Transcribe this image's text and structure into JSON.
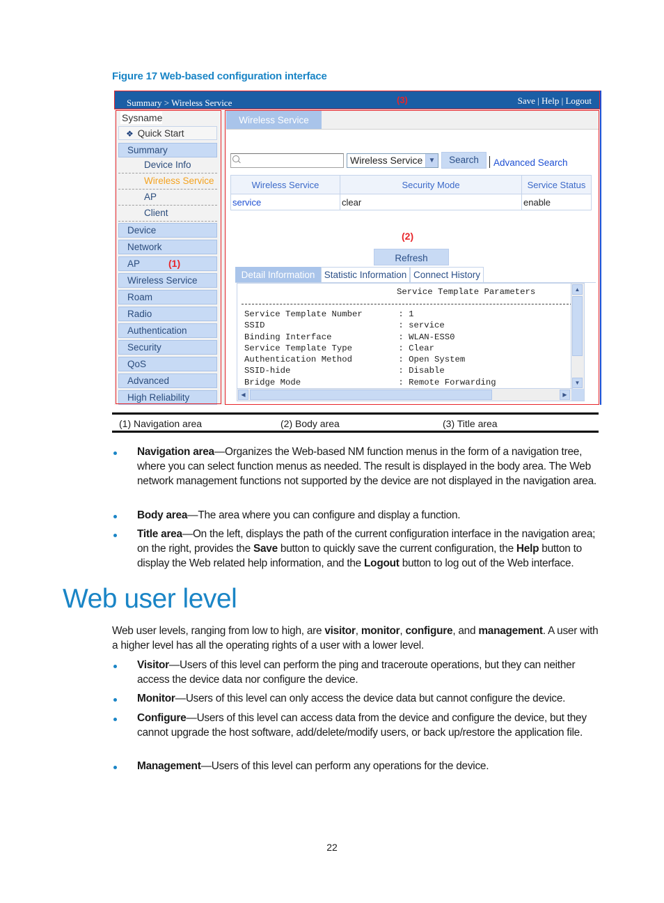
{
  "figure_caption": "Figure 17 Web-based configuration interface",
  "ui": {
    "title_area": {
      "breadcrumb": "Summary > Wireless Service",
      "save": "Save",
      "help": "Help",
      "logout": "Logout",
      "separator": " | "
    },
    "markers": {
      "nav": "(1)",
      "body": "(2)",
      "title": "(3)"
    },
    "navigation": {
      "sysname": "Sysname",
      "quick_start": "Quick Start",
      "summary": {
        "label": "Summary",
        "children": [
          "Device Info",
          "Wireless Service",
          "AP",
          "Client"
        ],
        "active_child": "Wireless Service"
      },
      "groups": [
        "Device",
        "Network",
        "AP",
        "Wireless Service",
        "Roam",
        "Radio",
        "Authentication",
        "Security",
        "QoS",
        "Advanced",
        "High Reliability"
      ]
    },
    "body": {
      "tab": "Wireless Service",
      "search": {
        "value": "",
        "placeholder": ""
      },
      "search_field": "Wireless Service",
      "search_button": "Search",
      "advanced_search": "Advanced Search",
      "table": {
        "columns": [
          "Wireless Service",
          "Security Mode",
          "Service Status"
        ],
        "rows": [
          [
            "service",
            "clear",
            "enable"
          ]
        ]
      },
      "refresh_button": "Refresh",
      "detail_tabs": [
        "Detail Information",
        "Statistic Information",
        "Connect History"
      ],
      "active_detail_tab": "Detail Information",
      "detail_title": "Service Template Parameters",
      "parameters": [
        {
          "name": "Service Template Number",
          "value": "1"
        },
        {
          "name": "SSID",
          "value": "service"
        },
        {
          "name": "Binding Interface",
          "value": "WLAN-ESS0"
        },
        {
          "name": "Service Template Type",
          "value": "Clear"
        },
        {
          "name": "Authentication Method",
          "value": "Open System"
        },
        {
          "name": "SSID-hide",
          "value": "Disable"
        },
        {
          "name": "Bridge Mode",
          "value": "Remote Forwarding"
        }
      ]
    }
  },
  "legend": [
    "(1) Navigation area",
    "(2) Body area",
    "(3) Title area"
  ],
  "bullets_areas": [
    {
      "term": "Navigation area",
      "text": "—Organizes the Web-based NM function menus in the form of a navigation tree, where you can select function menus as needed. The result is displayed in the body area. The Web network management functions not supported by the device are not displayed in the navigation area."
    },
    {
      "term": "Body area",
      "text": "—The area where you can configure and display a function."
    },
    {
      "term": "Title area",
      "text_parts": [
        "—On the left, displays the path of the current configuration interface in the navigation area; on the right, provides the ",
        "Save",
        " button to quickly save the current configuration, the ",
        "Help",
        " button to display the Web related help information, and the ",
        "Logout",
        " button to log out of the Web interface."
      ]
    }
  ],
  "section_heading": "Web user level",
  "intro_parts": [
    "Web user levels, ranging from low to high, are ",
    "visitor",
    ", ",
    "monitor",
    ", ",
    "configure",
    ", and ",
    "management",
    ". A user with a higher level has all the operating rights of a user with a lower level."
  ],
  "bullets_levels": [
    {
      "term": "Visitor",
      "text": "—Users of this level can perform the ping and traceroute operations, but they can neither access the device data nor configure the device."
    },
    {
      "term": "Monitor",
      "text": "—Users of this level can only access the device data but cannot configure the device."
    },
    {
      "term": "Configure",
      "text": "—Users of this level can access data from the device and configure the device, but they cannot upgrade the host software, add/delete/modify users, or back up/restore the application file."
    },
    {
      "term": "Management",
      "text": "—Users of this level can perform any operations for the device."
    }
  ],
  "page_number": "22",
  "colors": {
    "accent": "#1a85c6",
    "title_bar": "#1b5ea5",
    "marker_red": "#e8252a",
    "nav_active": "#f4a21e",
    "link": "#1d4fd3"
  }
}
